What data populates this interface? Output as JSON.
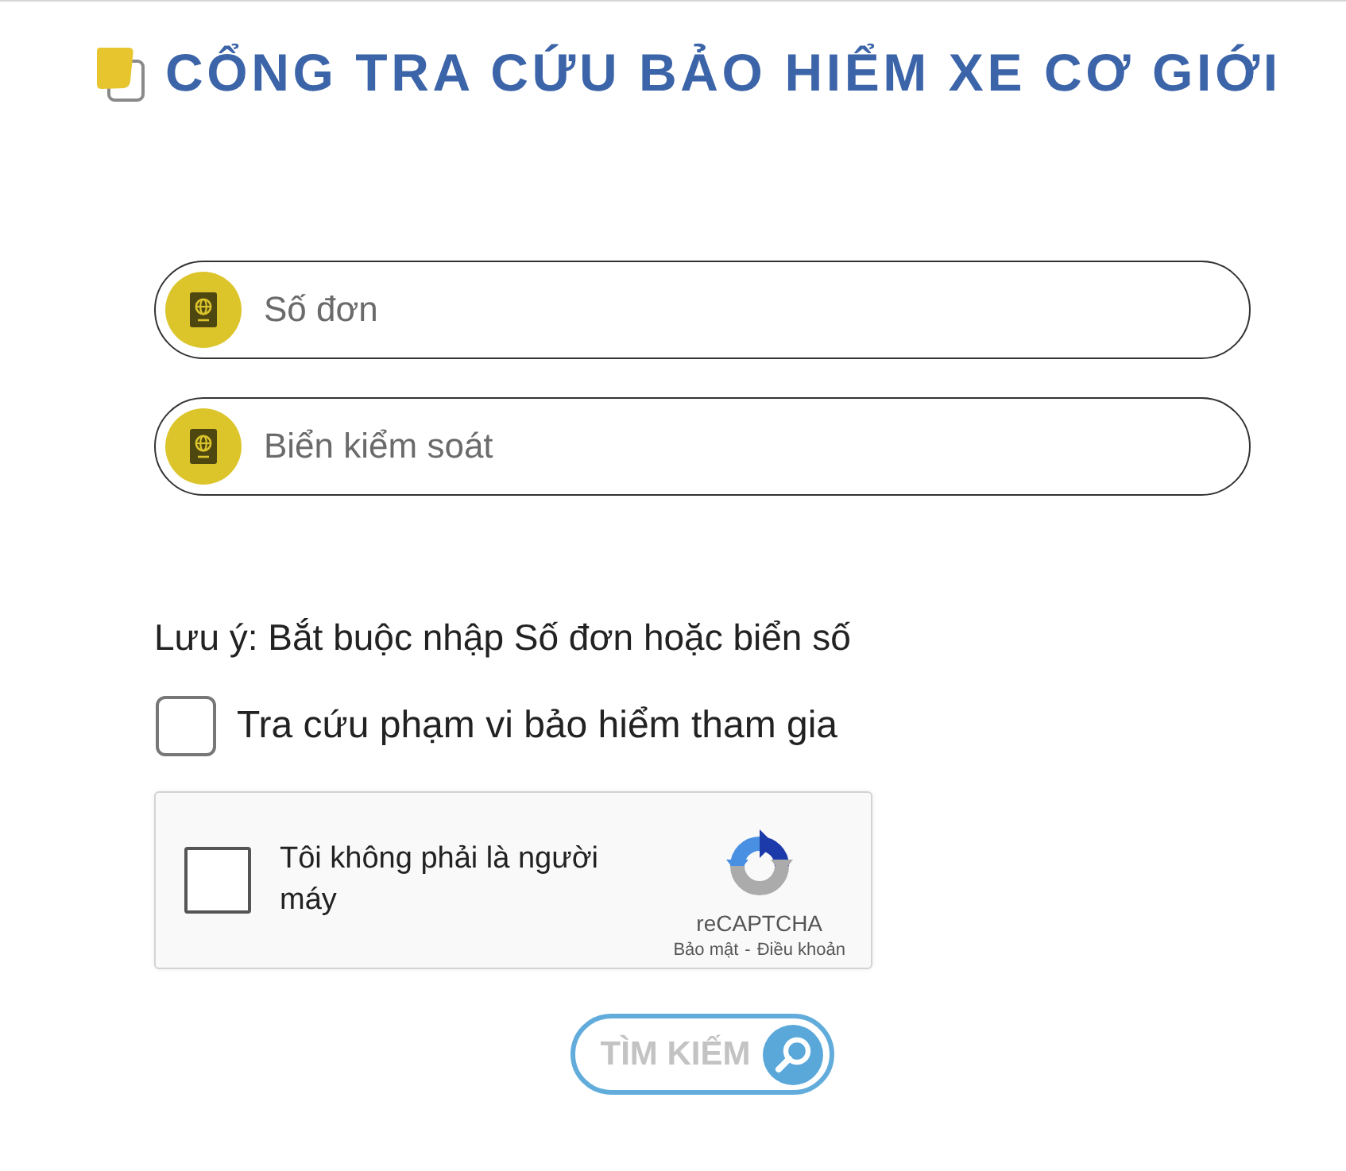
{
  "header": {
    "title": "CỔNG TRA CỨU BẢO HIỂM XE CƠ GIỚI"
  },
  "fields": [
    {
      "placeholder": "Số đơn"
    },
    {
      "placeholder": "Biển kiểm soát"
    }
  ],
  "note": "Lưu ý: Bắt buộc nhập Số đơn hoặc biển số",
  "scope_checkbox": {
    "label": "Tra cứu phạm vi bảo hiểm tham gia",
    "checked": false
  },
  "captcha": {
    "label": "Tôi không phải là người máy",
    "checked": false,
    "brand": "reCAPTCHA",
    "links": [
      "Bảo mật",
      "Điều khoản"
    ],
    "separator": "-"
  },
  "search_button": {
    "label": "TÌM KIẾM"
  }
}
